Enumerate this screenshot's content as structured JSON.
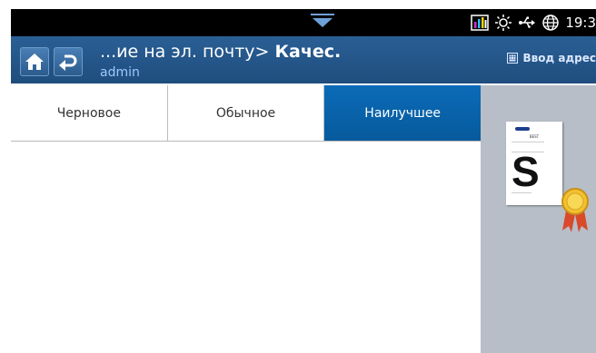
{
  "status": {
    "time": "19:3",
    "icons": [
      "toner-icon",
      "sun-icon",
      "usb-icon",
      "globe-icon"
    ]
  },
  "header": {
    "title_prefix": "...ие на эл. почту>",
    "title_bold": "Качес.",
    "user": "admin",
    "address_label": "Ввод адрес"
  },
  "tabs": [
    {
      "label": "Черновое",
      "selected": false
    },
    {
      "label": "Обычное",
      "selected": false
    },
    {
      "label": "Наилучшее",
      "selected": true
    }
  ],
  "preview": {
    "paper_letter": "S",
    "paper_heading": "BEST"
  },
  "colors": {
    "header": "#245789",
    "tab_active": "#0a64ad",
    "preview_bg": "#b8bec7"
  }
}
